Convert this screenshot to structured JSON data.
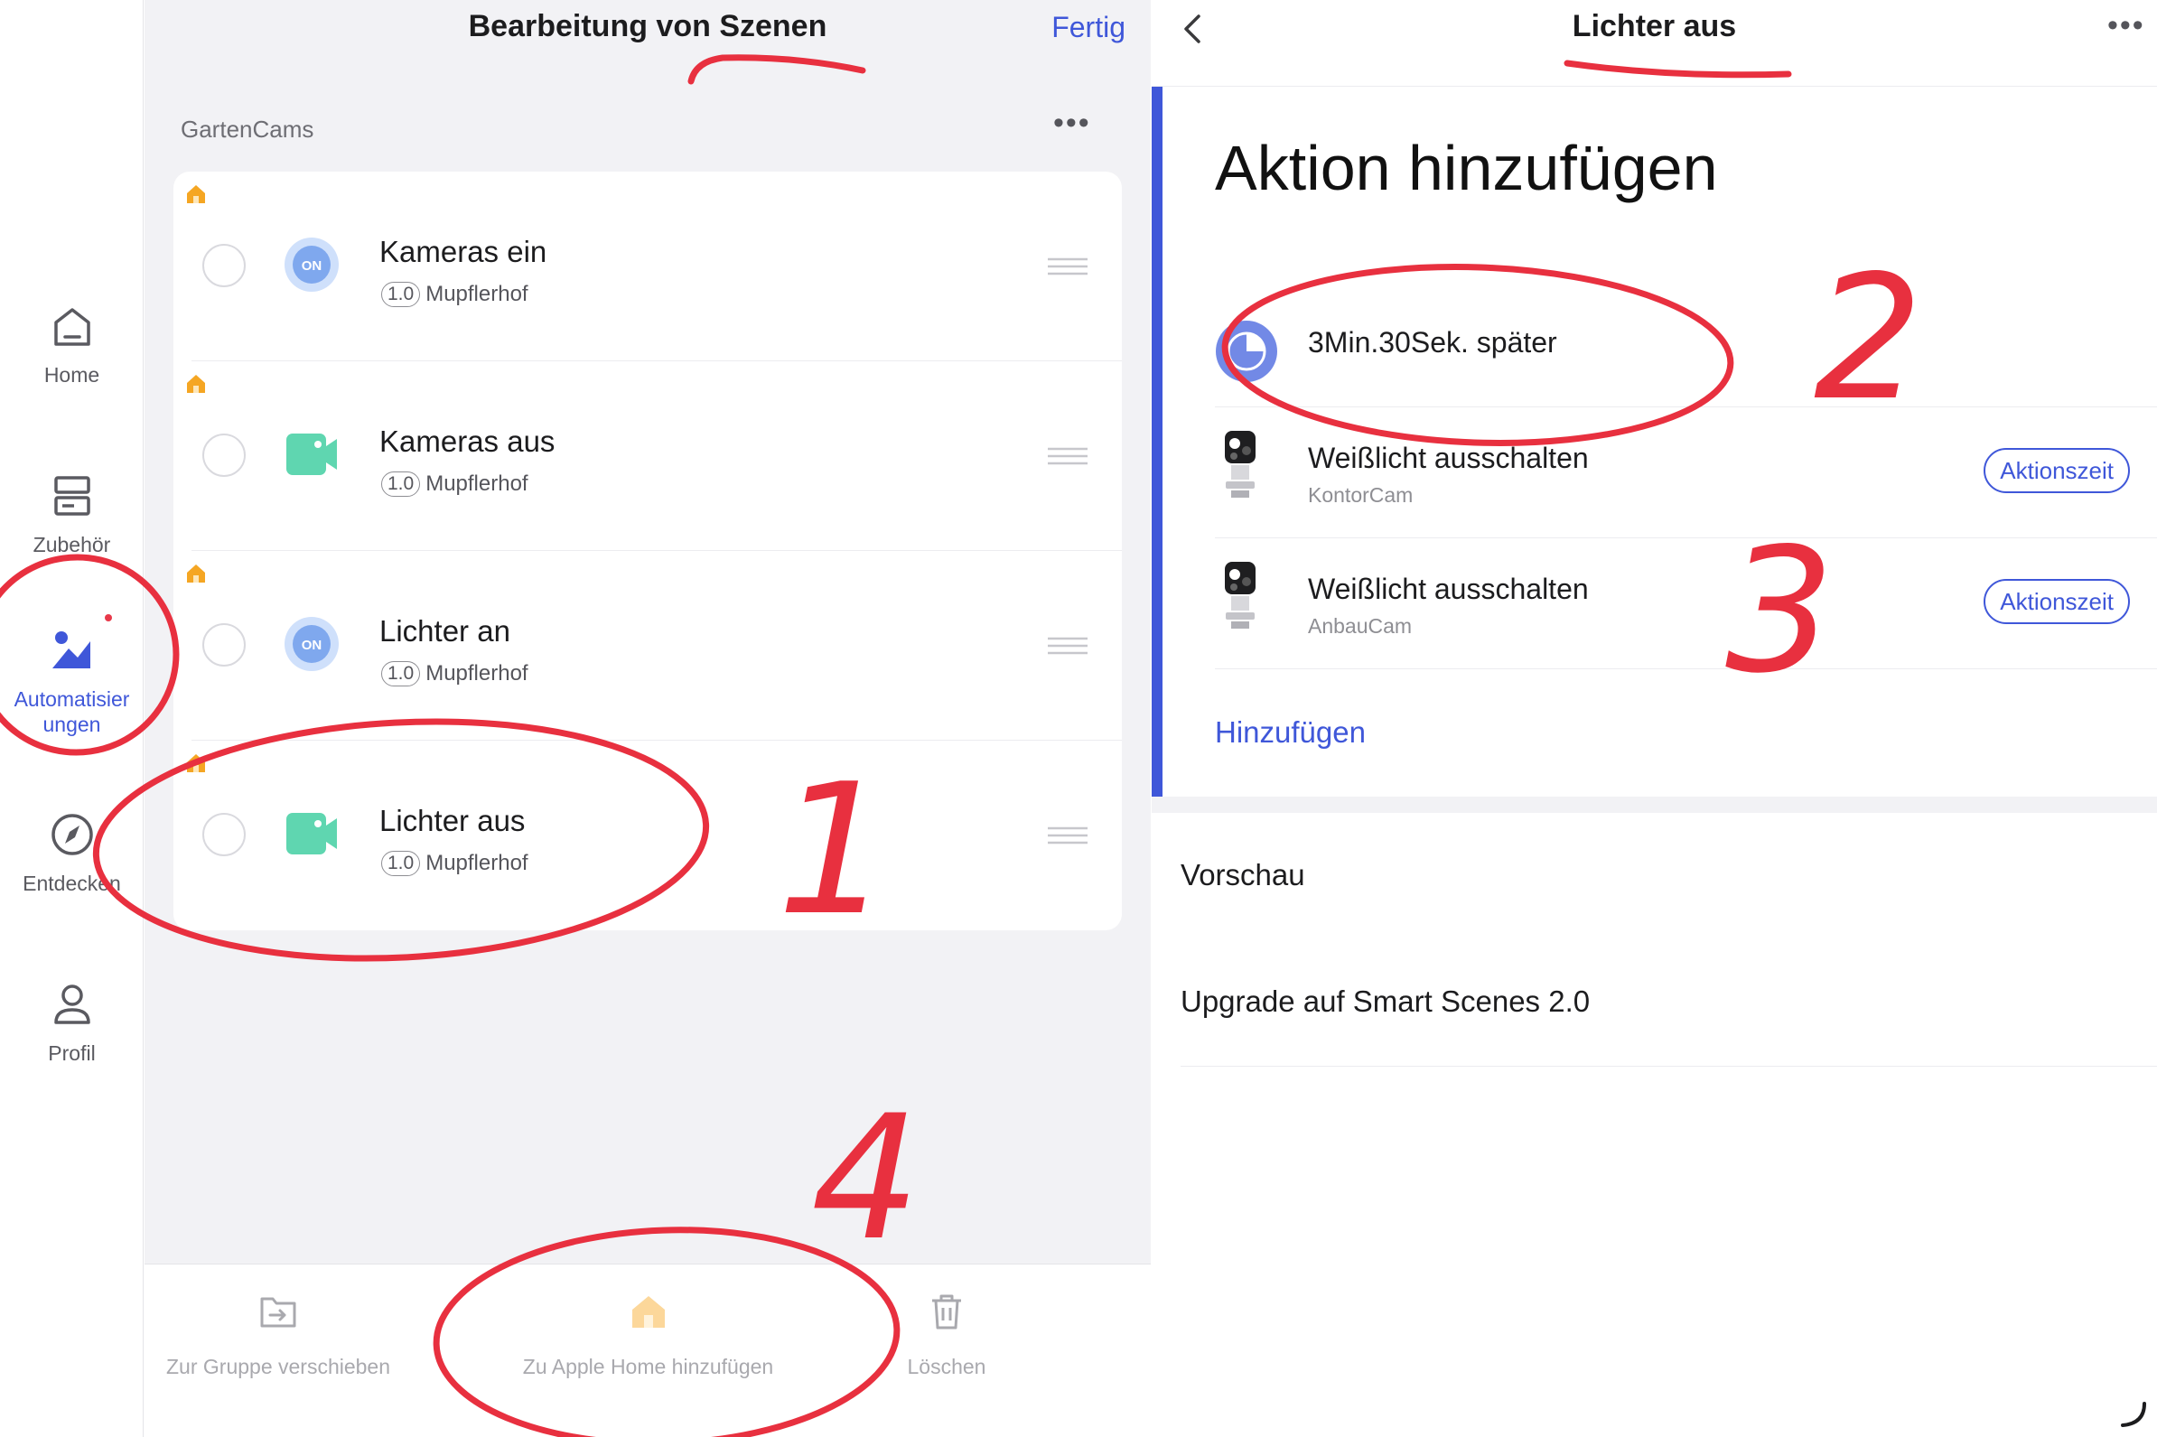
{
  "sidebar": {
    "items": [
      {
        "label": "Home",
        "icon": "home-icon"
      },
      {
        "label": "Zubehör",
        "icon": "accessories-icon"
      },
      {
        "label": "Automatisier\nungen",
        "icon": "automation-icon",
        "active": true
      },
      {
        "label": "Entdecken",
        "icon": "compass-icon"
      },
      {
        "label": "Profil",
        "icon": "profile-icon"
      }
    ]
  },
  "scene_editor": {
    "title": "Bearbeitung von Szenen",
    "done_label": "Fertig",
    "group_name": "GartenCams",
    "more_label": "•••",
    "scenes": [
      {
        "name": "Kameras ein",
        "version": "1.0",
        "location": "Mupflerhof",
        "icon": "on-icon"
      },
      {
        "name": "Kameras aus",
        "version": "1.0",
        "location": "Mupflerhof",
        "icon": "camera-icon"
      },
      {
        "name": "Lichter an",
        "version": "1.0",
        "location": "Mupflerhof",
        "icon": "on-icon"
      },
      {
        "name": "Lichter aus",
        "version": "1.0",
        "location": "Mupflerhof",
        "icon": "camera-icon"
      }
    ],
    "toolbar": {
      "move_label": "Zur Gruppe verschieben",
      "apple_home_label": "Zu Apple Home hinzufügen",
      "delete_label": "Löschen"
    }
  },
  "scene_detail": {
    "title": "Lichter aus",
    "more_label": "•••",
    "heading": "Aktion hinzufügen",
    "delay_action": "3Min.30Sek. später",
    "actions": [
      {
        "title": "Weißlicht ausschalten",
        "device": "KontorCam",
        "button": "Aktionszeit"
      },
      {
        "title": "Weißlicht ausschalten",
        "device": "AnbauCam",
        "button": "Aktionszeit"
      }
    ],
    "add_label": "Hinzufügen",
    "preview_label": "Vorschau",
    "upgrade_label": "Upgrade auf Smart Scenes 2.0"
  },
  "annotations": {
    "numbers": [
      "1",
      "2",
      "3",
      "4"
    ],
    "color": "#e8303f"
  },
  "colors": {
    "accent": "#3f57d9",
    "on_icon": "#7fa8ee",
    "camera_icon": "#5fd6b0",
    "home_badge": "#f5a623"
  }
}
